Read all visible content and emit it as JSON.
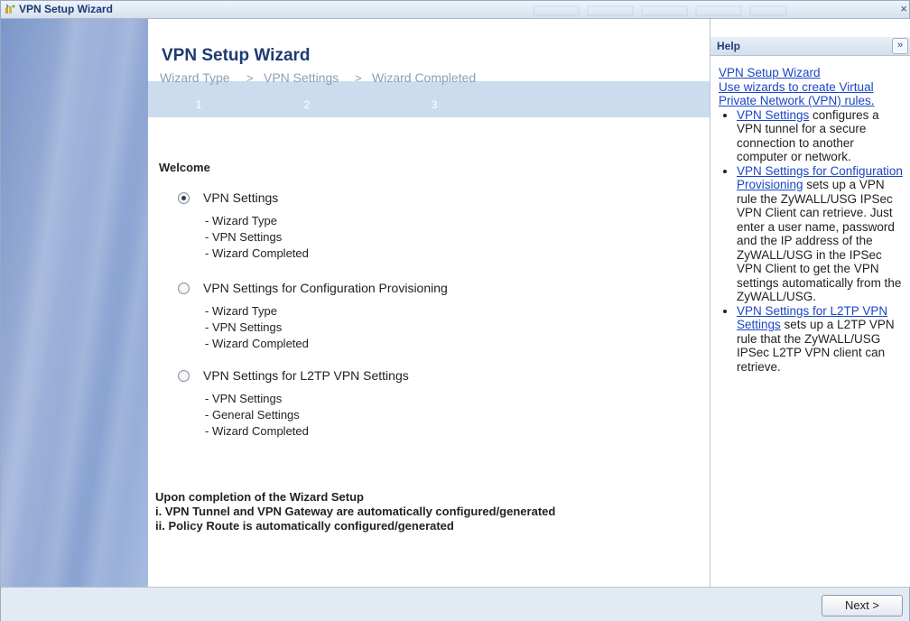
{
  "window": {
    "title": "VPN Setup Wizard",
    "close_icon": "close-icon",
    "close_glyph": "×"
  },
  "main": {
    "title": "VPN Setup Wizard",
    "steps": [
      {
        "label": "Wizard Type",
        "number": "1"
      },
      {
        "label": "VPN Settings",
        "number": "2"
      },
      {
        "label": "Wizard Completed",
        "number": "3"
      }
    ],
    "step_separator": ">",
    "welcome": "Welcome",
    "options": [
      {
        "label": "VPN Settings",
        "selected": true,
        "items": [
          "- Wizard Type",
          "- VPN Settings",
          "- Wizard Completed"
        ]
      },
      {
        "label": "VPN Settings for Configuration Provisioning",
        "selected": false,
        "items": [
          "- Wizard Type",
          "- VPN Settings",
          "- Wizard Completed"
        ]
      },
      {
        "label": "VPN Settings for L2TP VPN Settings",
        "selected": false,
        "items": [
          "- VPN Settings",
          "- General Settings",
          "- Wizard Completed"
        ]
      }
    ],
    "completion": [
      "Upon completion of the Wizard Setup",
      "i. VPN Tunnel and VPN Gateway are automatically configured/generated",
      "ii. Policy Route is automatically configured/generated"
    ]
  },
  "help": {
    "title": "Help",
    "expand_glyph": "»",
    "link_wizard": "VPN Setup Wizard",
    "link_intro": "Use wizards to create Virtual Private Network (VPN) rules.",
    "b1_link": "VPN Settings",
    "b1_text": " configures a VPN tunnel for a secure connection to another computer or network.",
    "b2_link": "VPN Settings for Configuration Provisioning",
    "b2_text": " sets up a VPN rule the ZyWALL/USG IPSec VPN Client can retrieve. Just enter a user name, password and the IP address of the ZyWALL/USG in the IPSec VPN Client to get the VPN settings automatically from the ZyWALL/USG.",
    "b3_link": "VPN Settings for L2TP VPN Settings",
    "b3_text": " sets up a L2TP VPN rule that the ZyWALL/USG IPSec L2TP VPN client can retrieve."
  },
  "footer": {
    "next_label": "Next >"
  },
  "colors": {
    "title_blue": "#1d3b72",
    "steps_bg": "#cbdcef",
    "link_blue": "#1a45c8",
    "sidebar_blue": "#8aa3d2"
  }
}
